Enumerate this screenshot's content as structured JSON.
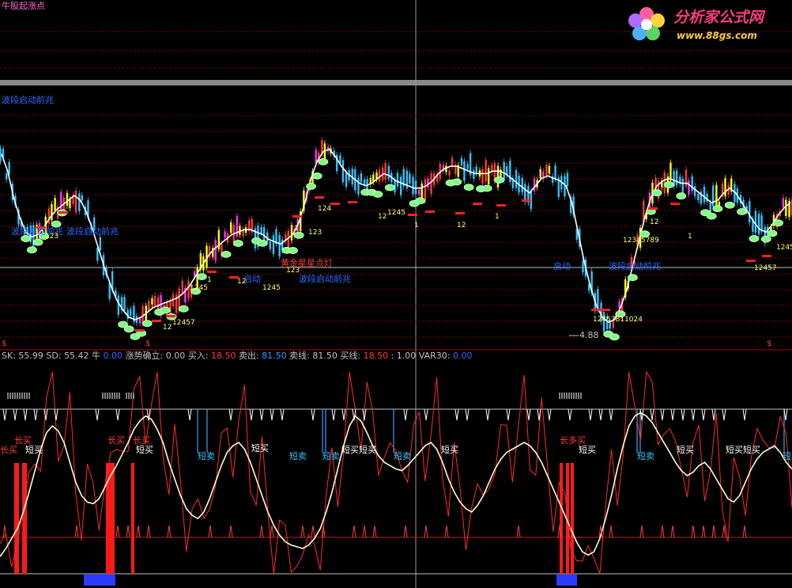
{
  "panel_top": {
    "title": "牛股起涨点"
  },
  "panel_main": {
    "title": "波段启动前兆"
  },
  "annotations": {
    "low_price": "4.88",
    "wave_start": "波段启动前兆",
    "gold_star": "黄金星星点灯",
    "launch": "启动",
    "start_up": "启动",
    "tag_12": "12",
    "tag_1": "1",
    "tag_124": "124",
    "tag_1245": "1245",
    "tag_12457": "12457",
    "tag_123": "123",
    "tag_12345789": "12345789",
    "tag_12457811024": "12457811024",
    "tag_1245x": "12457",
    "money_mark": "$"
  },
  "indicator_bar": {
    "items": [
      {
        "label": "SK:",
        "value": "55.99",
        "color": "#c0c0c0"
      },
      {
        "label": "SD:",
        "value": "55.42",
        "color": "#c0c0c0"
      },
      {
        "label": "牛",
        "value": "0.00",
        "color": "#2a6cff"
      },
      {
        "label": "涨势确立:",
        "value": "0.00",
        "color": "#c0c0c0"
      },
      {
        "label": "买入:",
        "value": "18.50",
        "color": "#ff3b3b"
      },
      {
        "label": "卖出:",
        "value": "81.50",
        "color": "#2a9cff"
      },
      {
        "label": "卖线:",
        "value": "81.50",
        "color": "#c0c0c0"
      },
      {
        "label": "买线:",
        "value": "18.50",
        "color": "#ff3b3b"
      },
      {
        "label": ":",
        "value": "1.00",
        "color": "#c0c0c0"
      },
      {
        "label": "VAR30:",
        "value": "0.00",
        "color": "#2a6cff"
      }
    ]
  },
  "signals": {
    "long_buy": "长买",
    "long_buy2": "长多买",
    "short_buy": "短买",
    "short_sell": "短卖"
  },
  "logo": {
    "text": "分析家公式网",
    "url_text": "www.88gs.com"
  },
  "colors": {
    "up": "#ff3b3b",
    "down": "#33c3ff",
    "white": "#ffffff",
    "yellow": "#ffff00",
    "magenta": "#ff33ff",
    "gem": "#7fff7f"
  },
  "chart_data": {
    "type": "line",
    "series": [
      {
        "values": [
          12.2,
          11.5,
          10.4,
          9.6,
          9.0,
          8.8,
          8.9,
          9.2,
          9.6,
          9.9,
          10.1,
          10.3,
          10.5,
          10.3,
          9.8,
          9.1,
          8.3,
          7.5,
          6.8,
          6.2,
          5.8,
          5.5,
          5.4,
          5.5,
          5.7,
          5.9,
          6.0,
          6.1,
          6.2,
          6.3,
          6.5,
          6.8,
          7.2,
          7.6,
          8.0,
          8.3,
          8.5,
          8.7,
          8.9,
          9.0,
          9.1,
          9.1,
          9.0,
          8.9,
          8.7,
          8.6,
          8.5,
          8.7,
          8.9,
          9.4,
          10.2,
          11.2,
          11.9,
          12.3,
          12.4,
          12.1,
          11.7,
          11.4,
          11.2,
          11.0,
          10.9,
          11.0,
          11.2,
          11.4,
          11.3,
          11.1,
          11.0,
          10.9,
          10.8,
          10.8,
          10.9,
          11.1,
          11.4,
          11.6,
          11.7,
          11.7,
          11.6,
          11.5,
          11.4,
          11.4,
          11.4,
          11.5,
          11.5,
          11.4,
          11.2,
          11.0,
          10.8,
          10.6,
          10.9,
          11.2,
          11.3,
          11.2,
          11.1,
          10.9,
          10.2,
          9.0,
          7.8,
          6.8,
          6.0,
          5.5,
          5.3,
          5.4,
          5.9,
          6.6,
          7.6,
          8.6,
          9.6,
          10.4,
          10.9,
          11.1,
          11.2,
          11.1,
          11.0,
          11.0,
          10.8,
          10.6,
          10.4,
          10.2,
          10.3,
          10.6,
          10.8,
          10.6,
          10.2,
          9.8,
          9.4,
          9.1,
          9.0,
          9.3,
          9.7,
          10.0,
          10.2
        ]
      },
      {
        "values": [
          3,
          8,
          14,
          20,
          30,
          42,
          55,
          68,
          78,
          82,
          79,
          72,
          60,
          48,
          40,
          36,
          35,
          38,
          45,
          52,
          58,
          65,
          72,
          80,
          85,
          88,
          86,
          80,
          72,
          60,
          50,
          40,
          32,
          28,
          26,
          30,
          38,
          48,
          58,
          66,
          70,
          72,
          68,
          60,
          50,
          40,
          30,
          22,
          16,
          12,
          10,
          9,
          8,
          10,
          14,
          20,
          30,
          42,
          56,
          70,
          82,
          88,
          85,
          78,
          70,
          64,
          60,
          58,
          56,
          55,
          58,
          62,
          66,
          70,
          72,
          68,
          60,
          50,
          42,
          36,
          32,
          30,
          34,
          40,
          48,
          56,
          62,
          66,
          68,
          70,
          72,
          70,
          66,
          60,
          52,
          44,
          36,
          28,
          20,
          12,
          6,
          4,
          6,
          14,
          26,
          40,
          56,
          70,
          82,
          88,
          90,
          88,
          84,
          78,
          72,
          66,
          60,
          55,
          52,
          54,
          58,
          60,
          56,
          50,
          44,
          38,
          36,
          40,
          48,
          56,
          62,
          66,
          68,
          70,
          66,
          60,
          56
        ]
      }
    ],
    "y_labels_main": [
      "4.88"
    ]
  }
}
